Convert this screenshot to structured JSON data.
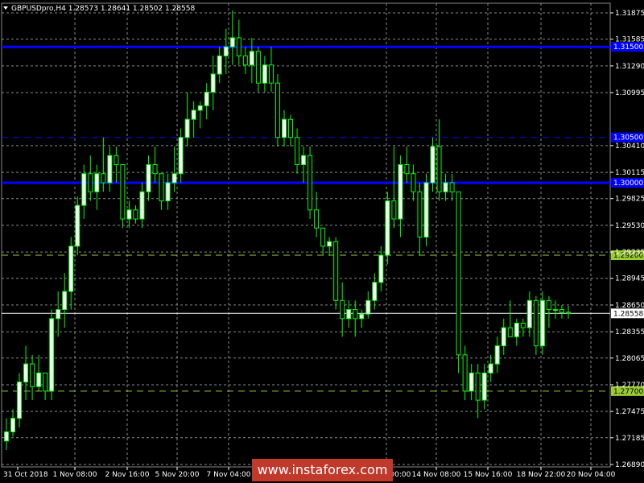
{
  "chart_data": {
    "type": "candlestick",
    "title": "GBPUSDpro,H4  1.28573 1.28641 1.28502 1.28558",
    "price_ticks": [
      "1.31875",
      "1.31585",
      "1.31290",
      "1.30995",
      "1.30410",
      "1.30115",
      "1.29825",
      "1.29530",
      "1.29235",
      "1.28945",
      "1.28650",
      "1.28355",
      "1.28065",
      "1.27770",
      "1.27475",
      "1.27185",
      "1.26890"
    ],
    "time_labels": [
      "31 Oct 2018",
      "1 Nov 08:00",
      "2 Nov 16:00",
      "5 Nov 20:00",
      "7 Nov 04:00",
      "13 Nov 00:00",
      "14 Nov 08:00",
      "15 Nov 16:00",
      "18 Nov 22:00",
      "20 Nov 04:00"
    ],
    "hlines": [
      {
        "price": 1.315,
        "label": "1.31500",
        "color": "#0000ff",
        "style": "solid"
      },
      {
        "price": 1.305,
        "label": "1.30500",
        "color": "#0000ff",
        "style": "dashed"
      },
      {
        "price": 1.3,
        "label": "1.30000",
        "color": "#0000ff",
        "style": "solid"
      },
      {
        "price": 1.292,
        "label": "1.29200",
        "color": "#9acd32",
        "style": "dashed"
      },
      {
        "price": 1.277,
        "label": "1.27700",
        "color": "#9acd32",
        "style": "dashed"
      },
      {
        "price": 1.28558,
        "label": "1.28558",
        "color": "#ffffff",
        "style": "solid"
      }
    ],
    "bull_color": "#ffffff",
    "bear_color": "#000000",
    "wick_color": "#00ff00",
    "candles": [
      [
        1.2715,
        1.274,
        1.2705,
        1.2725
      ],
      [
        1.2725,
        1.275,
        1.272,
        1.274
      ],
      [
        1.274,
        1.279,
        1.273,
        1.278
      ],
      [
        1.278,
        1.282,
        1.276,
        1.28
      ],
      [
        1.28,
        1.281,
        1.276,
        1.2775
      ],
      [
        1.2775,
        1.281,
        1.277,
        1.279
      ],
      [
        1.279,
        1.278,
        1.276,
        1.277
      ],
      [
        1.277,
        1.286,
        1.276,
        1.285
      ],
      [
        1.285,
        1.288,
        1.283,
        1.286
      ],
      [
        1.286,
        1.29,
        1.284,
        1.288
      ],
      [
        1.288,
        1.294,
        1.286,
        1.293
      ],
      [
        1.293,
        1.2985,
        1.292,
        1.2975
      ],
      [
        1.2975,
        1.302,
        1.296,
        1.301
      ],
      [
        1.301,
        1.303,
        1.298,
        1.299
      ],
      [
        1.299,
        1.302,
        1.297,
        1.301
      ],
      [
        1.301,
        1.305,
        1.299,
        1.3
      ],
      [
        1.3,
        1.304,
        1.299,
        1.303
      ],
      [
        1.303,
        1.304,
        1.3,
        1.302
      ],
      [
        1.302,
        1.301,
        1.295,
        1.296
      ],
      [
        1.296,
        1.298,
        1.295,
        1.297
      ],
      [
        1.297,
        1.2975,
        1.2955,
        1.296
      ],
      [
        1.296,
        1.3,
        1.295,
        1.299
      ],
      [
        1.299,
        1.303,
        1.298,
        1.302
      ],
      [
        1.302,
        1.304,
        1.3,
        1.301
      ],
      [
        1.301,
        1.301,
        1.297,
        1.298
      ],
      [
        1.298,
        1.301,
        1.297,
        1.3
      ],
      [
        1.3,
        1.304,
        1.299,
        1.301
      ],
      [
        1.301,
        1.306,
        1.3,
        1.305
      ],
      [
        1.305,
        1.31,
        1.304,
        1.307
      ],
      [
        1.307,
        1.309,
        1.305,
        1.308
      ],
      [
        1.308,
        1.309,
        1.306,
        1.3085
      ],
      [
        1.3085,
        1.311,
        1.307,
        1.31
      ],
      [
        1.31,
        1.314,
        1.308,
        1.312
      ],
      [
        1.312,
        1.315,
        1.311,
        1.314
      ],
      [
        1.314,
        1.317,
        1.312,
        1.315
      ],
      [
        1.315,
        1.319,
        1.313,
        1.316
      ],
      [
        1.316,
        1.318,
        1.313,
        1.314
      ],
      [
        1.314,
        1.315,
        1.312,
        1.313
      ],
      [
        1.313,
        1.316,
        1.311,
        1.3145
      ],
      [
        1.3145,
        1.315,
        1.31,
        1.311
      ],
      [
        1.311,
        1.314,
        1.31,
        1.313
      ],
      [
        1.313,
        1.315,
        1.31,
        1.311
      ],
      [
        1.311,
        1.312,
        1.304,
        1.305
      ],
      [
        1.305,
        1.308,
        1.304,
        1.307
      ],
      [
        1.307,
        1.3075,
        1.304,
        1.305
      ],
      [
        1.305,
        1.306,
        1.301,
        1.302
      ],
      [
        1.302,
        1.304,
        1.3,
        1.303
      ],
      [
        1.303,
        1.304,
        1.296,
        1.297
      ],
      [
        1.297,
        1.299,
        1.294,
        1.295
      ],
      [
        1.295,
        1.2945,
        1.292,
        1.293
      ],
      [
        1.293,
        1.294,
        1.292,
        1.2935
      ],
      [
        1.2935,
        1.294,
        1.286,
        1.287
      ],
      [
        1.287,
        1.289,
        1.283,
        1.285
      ],
      [
        1.285,
        1.287,
        1.284,
        1.286
      ],
      [
        1.286,
        1.287,
        1.283,
        1.285
      ],
      [
        1.285,
        1.286,
        1.284,
        1.2855
      ],
      [
        1.2855,
        1.288,
        1.285,
        1.287
      ],
      [
        1.287,
        1.29,
        1.286,
        1.289
      ],
      [
        1.289,
        1.293,
        1.288,
        1.292
      ],
      [
        1.292,
        1.299,
        1.291,
        1.298
      ],
      [
        1.298,
        1.304,
        1.295,
        1.296
      ],
      [
        1.296,
        1.303,
        1.294,
        1.302
      ],
      [
        1.302,
        1.304,
        1.3,
        1.301
      ],
      [
        1.301,
        1.302,
        1.298,
        1.299
      ],
      [
        1.299,
        1.3,
        1.292,
        1.294
      ],
      [
        1.294,
        1.301,
        1.293,
        1.3
      ],
      [
        1.3,
        1.305,
        1.299,
        1.304
      ],
      [
        1.304,
        1.307,
        1.298,
        1.299
      ],
      [
        1.299,
        1.301,
        1.298,
        1.3
      ],
      [
        1.3,
        1.301,
        1.298,
        1.299
      ],
      [
        1.299,
        1.298,
        1.279,
        1.281
      ],
      [
        1.281,
        1.282,
        1.276,
        1.277
      ],
      [
        1.277,
        1.28,
        1.276,
        1.279
      ],
      [
        1.279,
        1.28,
        1.274,
        1.276
      ],
      [
        1.276,
        1.28,
        1.275,
        1.279
      ],
      [
        1.279,
        1.281,
        1.278,
        1.28
      ],
      [
        1.28,
        1.283,
        1.279,
        1.282
      ],
      [
        1.282,
        1.285,
        1.281,
        1.284
      ],
      [
        1.284,
        1.287,
        1.283,
        1.283
      ],
      [
        1.283,
        1.285,
        1.282,
        1.2845
      ],
      [
        1.2845,
        1.285,
        1.283,
        1.284
      ],
      [
        1.284,
        1.288,
        1.283,
        1.287
      ],
      [
        1.287,
        1.2875,
        1.281,
        1.282
      ],
      [
        1.282,
        1.288,
        1.281,
        1.287
      ],
      [
        1.287,
        1.2875,
        1.284,
        1.286
      ],
      [
        1.286,
        1.287,
        1.285,
        1.286
      ],
      [
        1.286,
        1.2865,
        1.285,
        1.2857
      ],
      [
        1.2857,
        1.2864,
        1.285,
        1.2856
      ]
    ]
  },
  "watermark": "www.instaforex.com"
}
